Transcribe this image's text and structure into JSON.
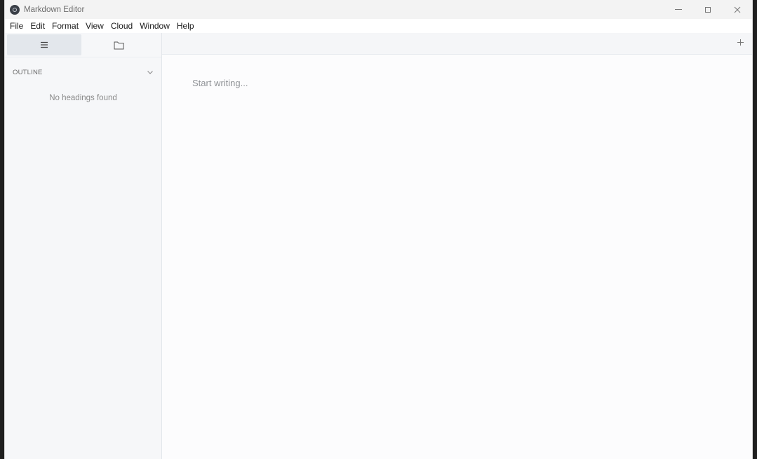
{
  "window": {
    "title": "Markdown Editor"
  },
  "menu": {
    "items": [
      "File",
      "Edit",
      "Format",
      "View",
      "Cloud",
      "Window",
      "Help"
    ]
  },
  "sidebar": {
    "tabs": [
      {
        "icon": "outline-list-icon",
        "active": true
      },
      {
        "icon": "folder-icon",
        "active": false
      }
    ],
    "outline": {
      "title": "OUTLINE",
      "empty_message": "No headings found"
    }
  },
  "editor": {
    "placeholder": "Start writing..."
  },
  "colors": {
    "window_bg": "#f7f8fa",
    "sidebar_bg": "#f6f7f9",
    "active_tab_bg": "#e3e7ec",
    "editor_bg": "#fcfcfd"
  }
}
